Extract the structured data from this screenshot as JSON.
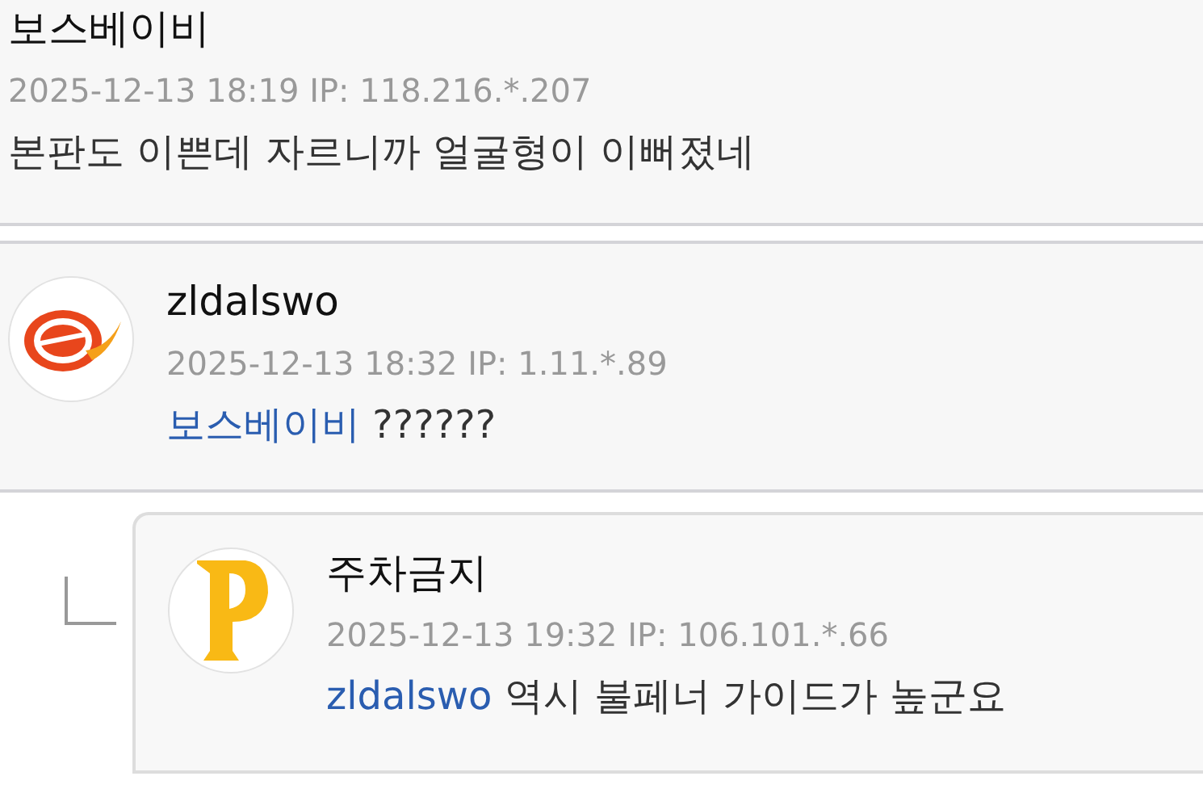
{
  "comments": [
    {
      "kind": "plain",
      "author": "보스베이비",
      "meta": "2025-12-13 18:19 IP: 118.216.*.207",
      "body": "본판도 이쁜데 자르니까 얼굴형이 이뻐졌네"
    },
    {
      "kind": "avatar",
      "avatar": {
        "kind": "swirl"
      },
      "author": "zldalswo",
      "meta": "2025-12-13 18:32 IP: 1.11.*.89",
      "mention": "보스베이비",
      "body": "??????"
    },
    {
      "kind": "reply",
      "avatar": {
        "kind": "letter"
      },
      "author": "주차금지",
      "meta": "2025-12-13 19:32 IP: 106.101.*.66",
      "mention": "zldalswo",
      "body": "역시 불페너 가이드가 높군요"
    }
  ]
}
